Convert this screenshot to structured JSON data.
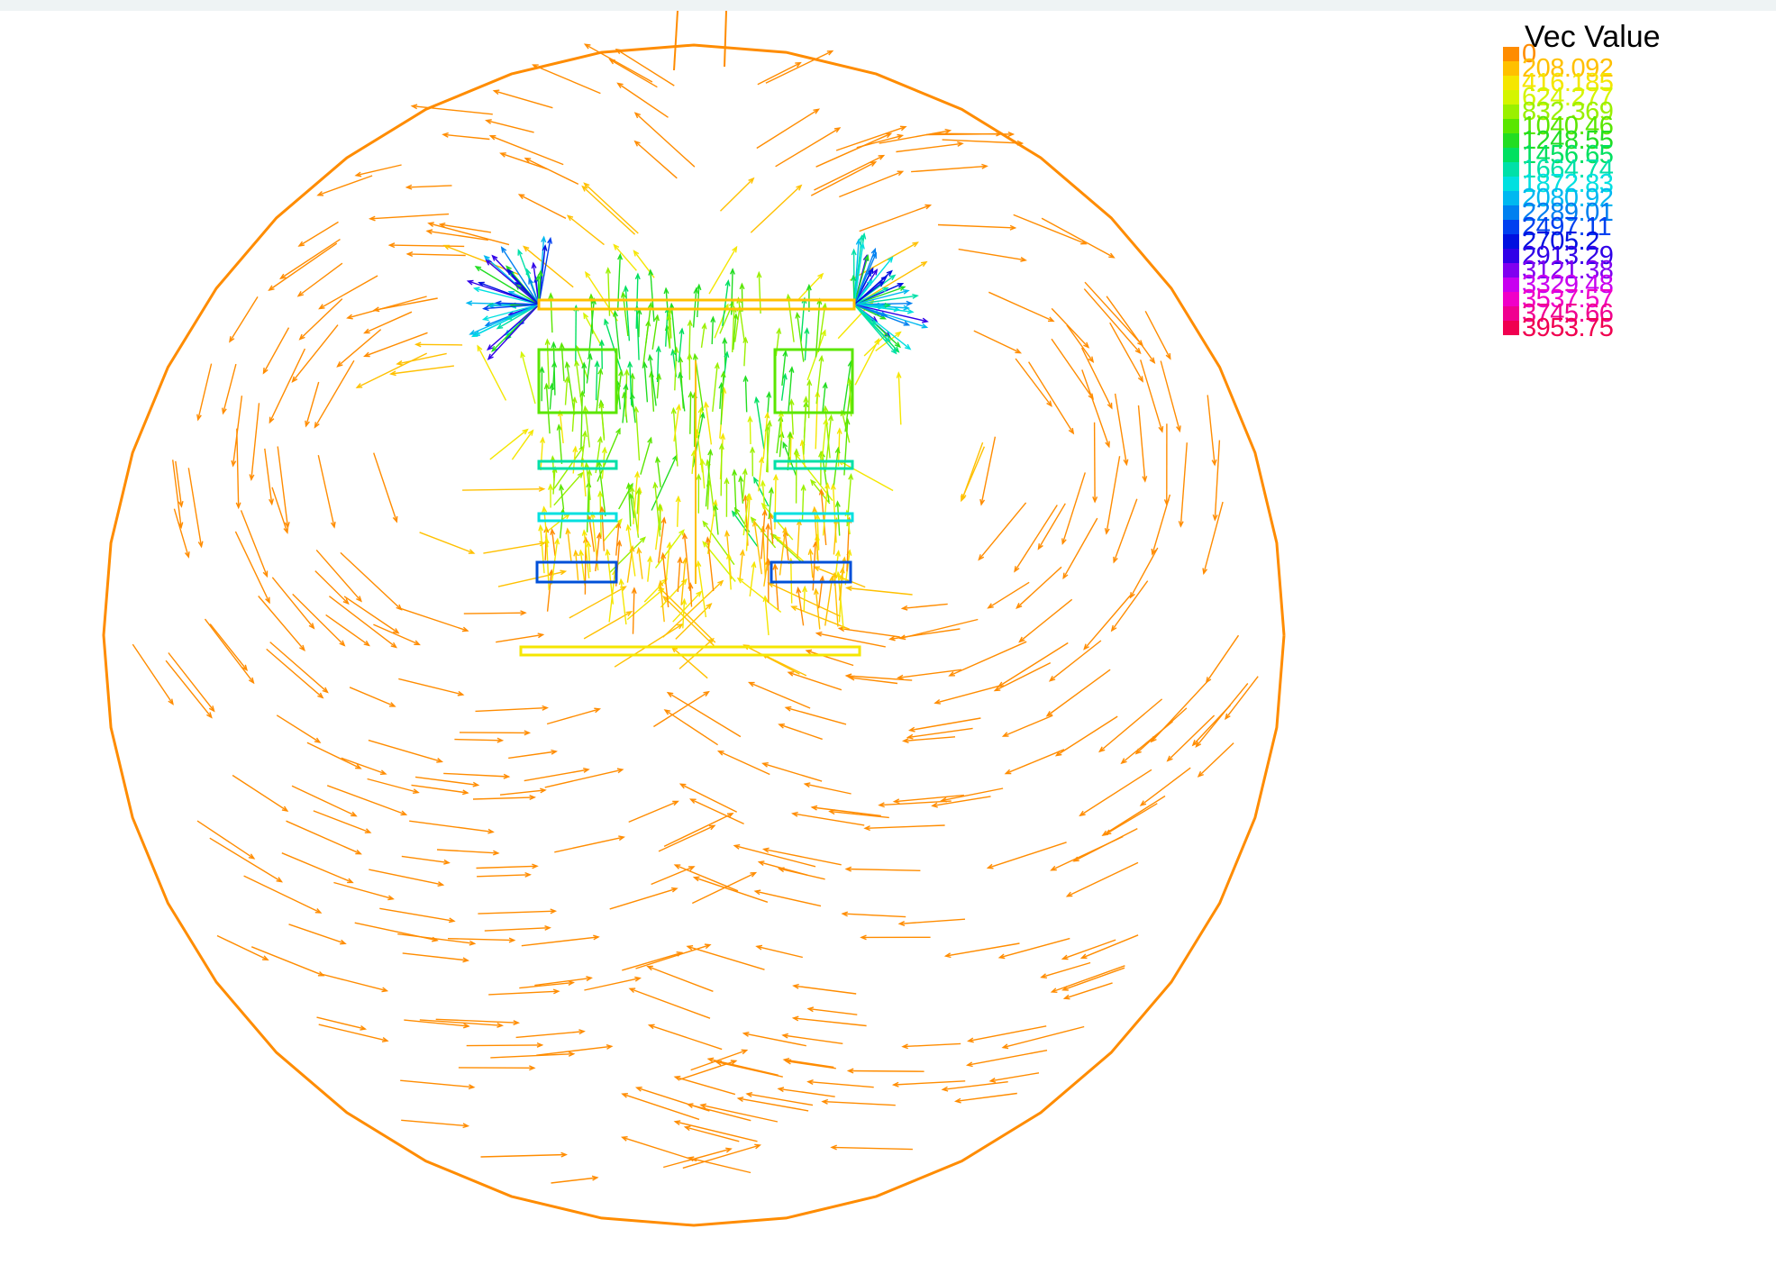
{
  "legend": {
    "title": "Vec Value",
    "entries": [
      {
        "label": "0",
        "color": "#ff8c00"
      },
      {
        "label": "208.092",
        "color": "#ffc000"
      },
      {
        "label": "416.185",
        "color": "#f5e600"
      },
      {
        "label": "624.277",
        "color": "#d4f500"
      },
      {
        "label": "832.369",
        "color": "#9af000"
      },
      {
        "label": "1040.46",
        "color": "#5ae600"
      },
      {
        "label": "1248.55",
        "color": "#22dd22"
      },
      {
        "label": "1456.65",
        "color": "#00e060"
      },
      {
        "label": "1664.74",
        "color": "#00e0a8"
      },
      {
        "label": "1872.83",
        "color": "#00e0e0"
      },
      {
        "label": "2080.92",
        "color": "#00b8f0"
      },
      {
        "label": "2289.01",
        "color": "#0080f0"
      },
      {
        "label": "2497.11",
        "color": "#0040f0"
      },
      {
        "label": "2705.2",
        "color": "#0010e0"
      },
      {
        "label": "2913.29",
        "color": "#3000e8"
      },
      {
        "label": "3121.38",
        "color": "#8000f0"
      },
      {
        "label": "3329.48",
        "color": "#c800f0"
      },
      {
        "label": "3537.57",
        "color": "#f000c8"
      },
      {
        "label": "3745.66",
        "color": "#f00090"
      },
      {
        "label": "3953.75",
        "color": "#f00050"
      }
    ]
  },
  "geometry_color": "#ff8c00",
  "coil_color": "#0050d8"
}
